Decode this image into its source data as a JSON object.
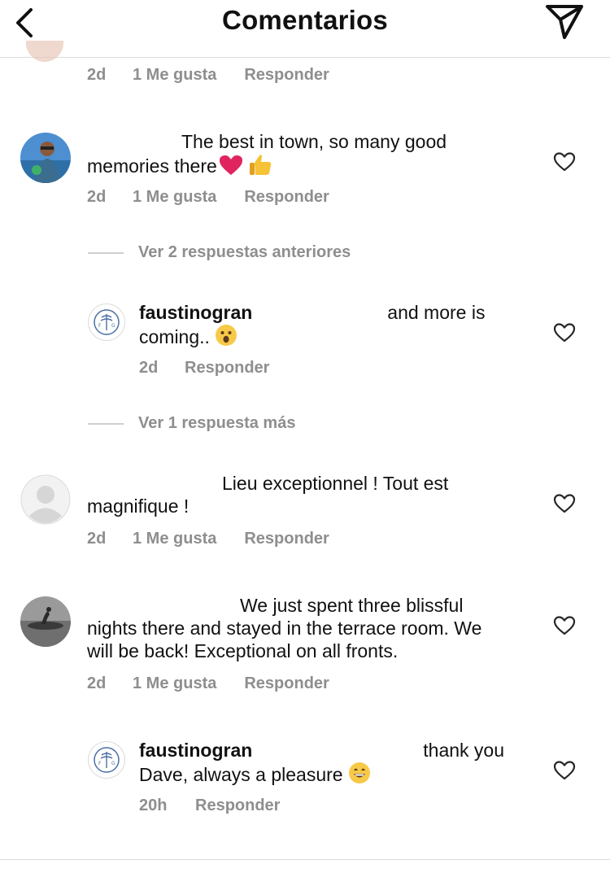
{
  "header": {
    "title": "Comentarios",
    "back_icon": "chevron-left-icon",
    "send_icon": "paper-plane-icon"
  },
  "top_partial": {
    "time": "2d",
    "likes": "1 Me gusta",
    "reply": "Responder"
  },
  "comments": [
    {
      "text": "The best in town, so many good memories there",
      "emojis": [
        "heart-emoji",
        "thumbs-up-emoji"
      ],
      "time": "2d",
      "likes": "1 Me gusta",
      "reply": "Responder"
    },
    {
      "username": "faustinogran",
      "text_after_redaction": "and more is coming..",
      "emojis": [
        "surprised-face-emoji"
      ],
      "time": "2d",
      "reply": "Responder"
    },
    {
      "text": "Lieu exceptionnel ! Tout est magnifique !",
      "time": "2d",
      "likes": "1 Me gusta",
      "reply": "Responder"
    },
    {
      "text": "We just spent three blissful nights there and stayed in the terrace room. We will be back! Exceptional on all fronts.",
      "time": "2d",
      "likes": "1 Me gusta",
      "reply": "Responder"
    },
    {
      "username": "faustinogran",
      "text_after_redaction": "thank you Dave, always a pleasure",
      "emojis": [
        "grinning-face-emoji"
      ],
      "time": "20h",
      "reply": "Responder"
    }
  ],
  "threads": [
    {
      "label": "Ver 2 respuestas anteriores"
    },
    {
      "label": "Ver 1 respuesta más"
    }
  ],
  "colors": {
    "text": "#111111",
    "muted": "#8e8e8e",
    "divider": "#dbdbdb",
    "heart_red": "#e0245e"
  }
}
